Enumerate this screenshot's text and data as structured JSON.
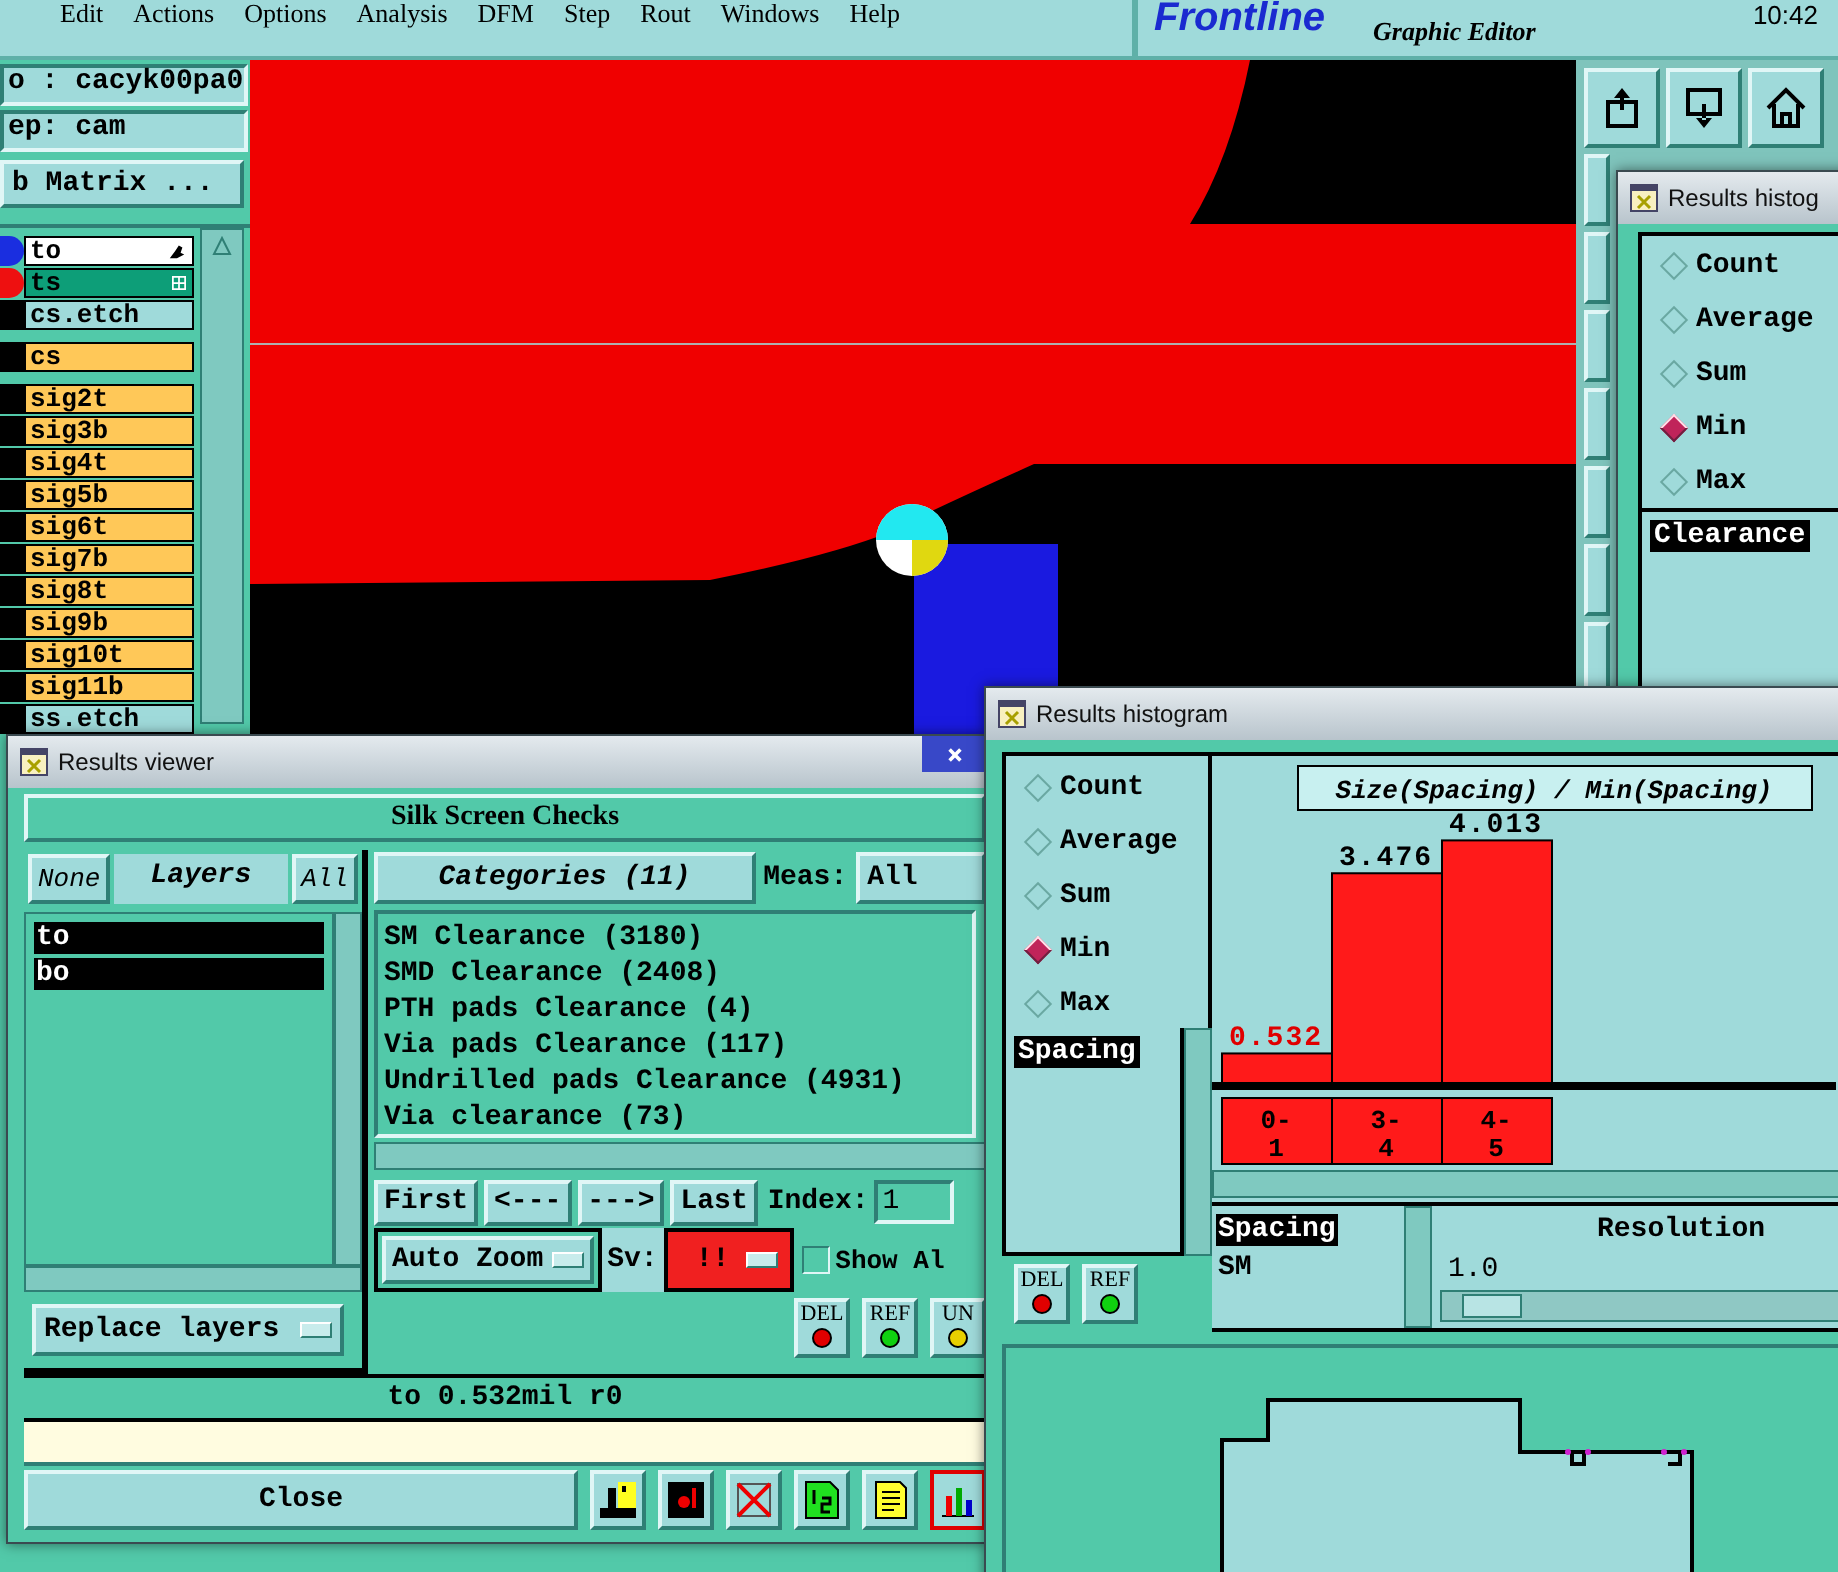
{
  "menu_bar": [
    "Edit",
    "Actions",
    "Options",
    "Analysis",
    "DFM",
    "Step",
    "Rout",
    "Windows",
    "Help"
  ],
  "logo": {
    "name": "Frontline",
    "subtitle": "Graphic Editor"
  },
  "clock": "10:42",
  "job_panel": {
    "job": "o : cacyk00pa0",
    "step": "ep: cam",
    "matrix_button": "b Matrix ..."
  },
  "layers": [
    {
      "name": "to",
      "kind": "work",
      "color": "#1a2ee0"
    },
    {
      "name": "ts",
      "kind": "affected",
      "color": "#ee1010"
    },
    {
      "name": "cs.etch",
      "kind": "etch"
    },
    {
      "name": "cs",
      "kind": "signal"
    },
    {
      "name": "sig2t",
      "kind": "signal"
    },
    {
      "name": "sig3b",
      "kind": "signal"
    },
    {
      "name": "sig4t",
      "kind": "signal"
    },
    {
      "name": "sig5b",
      "kind": "signal"
    },
    {
      "name": "sig6t",
      "kind": "signal"
    },
    {
      "name": "sig7b",
      "kind": "signal"
    },
    {
      "name": "sig8t",
      "kind": "signal"
    },
    {
      "name": "sig9b",
      "kind": "signal"
    },
    {
      "name": "sig10t",
      "kind": "signal"
    },
    {
      "name": "sig11b",
      "kind": "signal"
    },
    {
      "name": "ss.etch",
      "kind": "etch"
    }
  ],
  "back_histogram": {
    "title": "Results histog",
    "modes": [
      {
        "label": "Count",
        "selected": false
      },
      {
        "label": "Average",
        "selected": false
      },
      {
        "label": "Sum",
        "selected": false
      },
      {
        "label": "Min",
        "selected": true
      },
      {
        "label": "Max",
        "selected": false
      }
    ],
    "list": [
      "Clearance"
    ]
  },
  "viewer": {
    "title": "Results viewer",
    "heading": "Silk Screen Checks",
    "none_button": "None",
    "layers_label": "Layers",
    "all_button": "All",
    "layers": [
      {
        "name": "to",
        "selected": true
      },
      {
        "name": "bo",
        "selected": true
      }
    ],
    "categories_button": "Categories (11)",
    "meas_label": "Meas:",
    "meas_value": "All",
    "categories": [
      "SM Clearance (3180)",
      "SMD Clearance (2408)",
      "PTH pads Clearance (4)",
      "Via pads Clearance (117)",
      "Undrilled pads Clearance (4931)",
      "Via clearance (73)"
    ],
    "nav": [
      "First",
      "<---",
      "--->",
      "Last"
    ],
    "index_label": "Index:",
    "index_value": "1",
    "auto_zoom": "Auto Zoom",
    "sv_label": "Sv:",
    "sv_value": "!!",
    "show_all": {
      "label": "Show Al",
      "checked": false
    },
    "replace_layers": "Replace layers",
    "tool_buttons": [
      {
        "label": "DEL",
        "kind": "delete"
      },
      {
        "label": "REF",
        "kind": "refresh"
      },
      {
        "label": "UN",
        "kind": "undo"
      }
    ],
    "status": "to 0.532mil  r0",
    "close": "Close"
  },
  "histogram": {
    "title": "Results histogram",
    "modes": [
      {
        "label": "Count",
        "selected": false
      },
      {
        "label": "Average",
        "selected": false
      },
      {
        "label": "Sum",
        "selected": false
      },
      {
        "label": "Min",
        "selected": true
      },
      {
        "label": "Max",
        "selected": false
      }
    ],
    "list": [
      "Spacing"
    ],
    "buttons": [
      {
        "label": "DEL",
        "kind": "delete"
      },
      {
        "label": "REF",
        "kind": "refresh"
      }
    ],
    "chart_data": {
      "type": "bar",
      "title": "Size(Spacing) / Min(Spacing)",
      "categories": [
        "0-\n1",
        "3-\n4",
        "4-\n5"
      ],
      "values": [
        0.532,
        3.476,
        4.013
      ],
      "value_labels": [
        "0.532",
        "3.476",
        "4.013"
      ]
    },
    "measures": [
      {
        "label": "Spacing",
        "selected": true
      },
      {
        "label": "SM",
        "selected": false
      }
    ],
    "resolution": {
      "label": "Resolution",
      "value": "1.0",
      "level": 0.05
    }
  }
}
